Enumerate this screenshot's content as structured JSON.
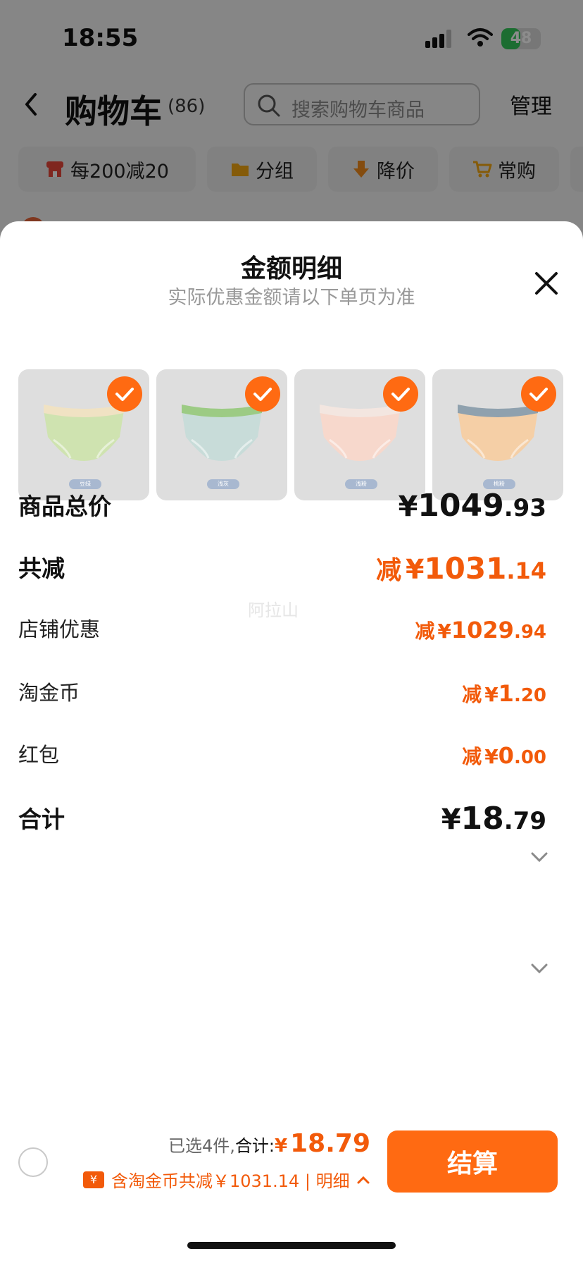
{
  "status_bar": {
    "time": "18:55",
    "battery": "48",
    "battery_level": 0.48
  },
  "nav": {
    "title": "购物车",
    "count": "(86)",
    "search_placeholder": "搜索购物车商品",
    "manage_label": "管理"
  },
  "chips": [
    {
      "label": "每200减20",
      "icon": "store-icon"
    },
    {
      "label": "分组",
      "icon": "folder-icon"
    },
    {
      "label": "降价",
      "icon": "price-drop-icon"
    },
    {
      "label": "常购",
      "icon": "cart-icon"
    }
  ],
  "sheet": {
    "title": "金额明细",
    "subtitle": "实际优惠金额请以下单页为准",
    "products": [
      {
        "tag": "豆绿",
        "body_color": "#cfe3b0",
        "band_color": "#f0e2c3",
        "selected": true
      },
      {
        "tag": "浅灰",
        "body_color": "#c8dcd9",
        "band_color": "#9ccb84",
        "selected": true
      },
      {
        "tag": "浅粉",
        "body_color": "#f7d8cc",
        "band_color": "#f3e6e0",
        "selected": true
      },
      {
        "tag": "桃粉",
        "body_color": "#f5cfa6",
        "band_color": "#8fa1ae",
        "selected": true
      }
    ],
    "watermark": "阿拉山",
    "rows": {
      "total": {
        "label": "商品总价",
        "currency": "¥",
        "int": "1049",
        "dec": ".93"
      },
      "saved": {
        "label": "共减",
        "prefix": "减",
        "currency": "¥",
        "int": "1031",
        "dec": ".14"
      },
      "shop": {
        "label": "店铺优惠",
        "prefix": "减",
        "currency": "¥",
        "int": "1029",
        "dec": ".94"
      },
      "coin": {
        "label": "淘金币",
        "prefix": "减",
        "currency": "¥",
        "int": "1",
        "dec": ".20"
      },
      "redpack": {
        "label": "红包",
        "prefix": "减",
        "currency": "¥",
        "int": "0",
        "dec": ".00"
      },
      "sum": {
        "label": "合计",
        "currency": "¥",
        "int": "18",
        "dec": ".79"
      }
    }
  },
  "bottom_bar": {
    "selected_text": "已选4件,",
    "total_label": "合计:",
    "currency": "¥",
    "total_value": "18.79",
    "discount_text": "含淘金币共减￥1031.14 | 明细",
    "checkout_label": "结算"
  },
  "colors": {
    "accent": "#ff6a12",
    "discount": "#f25a0a"
  }
}
